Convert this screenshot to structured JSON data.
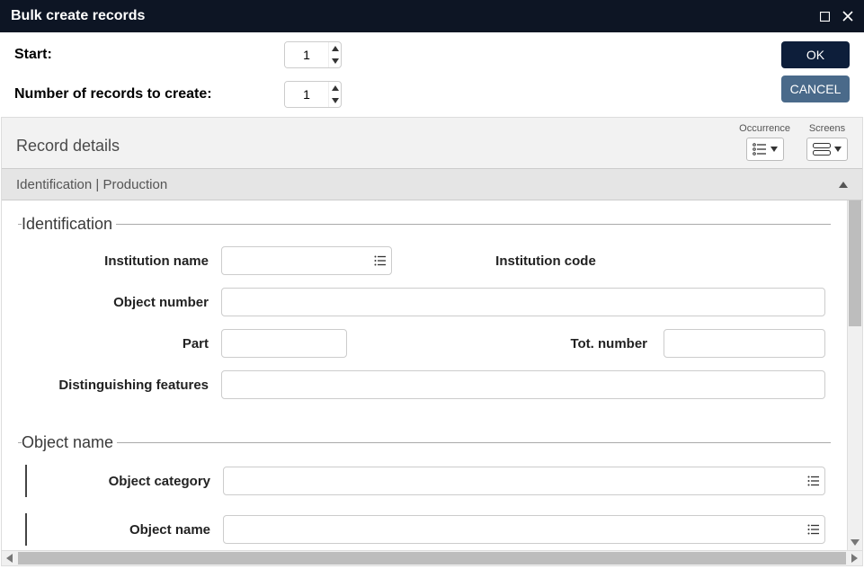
{
  "dialog": {
    "title": "Bulk create records"
  },
  "controls": {
    "start_label": "Start:",
    "start_value": "1",
    "count_label": "Number of records to create:",
    "count_value": "1",
    "ok_label": "OK",
    "cancel_label": "CANCEL"
  },
  "panel": {
    "title": "Record details",
    "occurrence_label": "Occurrence",
    "screens_label": "Screens",
    "tab_label": "Identification | Production"
  },
  "fields": {
    "identification_legend": "Identification",
    "institution_name_label": "Institution name",
    "institution_code_label": "Institution code",
    "object_number_label": "Object number",
    "part_label": "Part",
    "tot_number_label": "Tot. number",
    "distinguishing_label": "Distinguishing features",
    "objectname_legend": "Object name",
    "object_category_label": "Object category",
    "objectname_field_label": "Object name"
  }
}
